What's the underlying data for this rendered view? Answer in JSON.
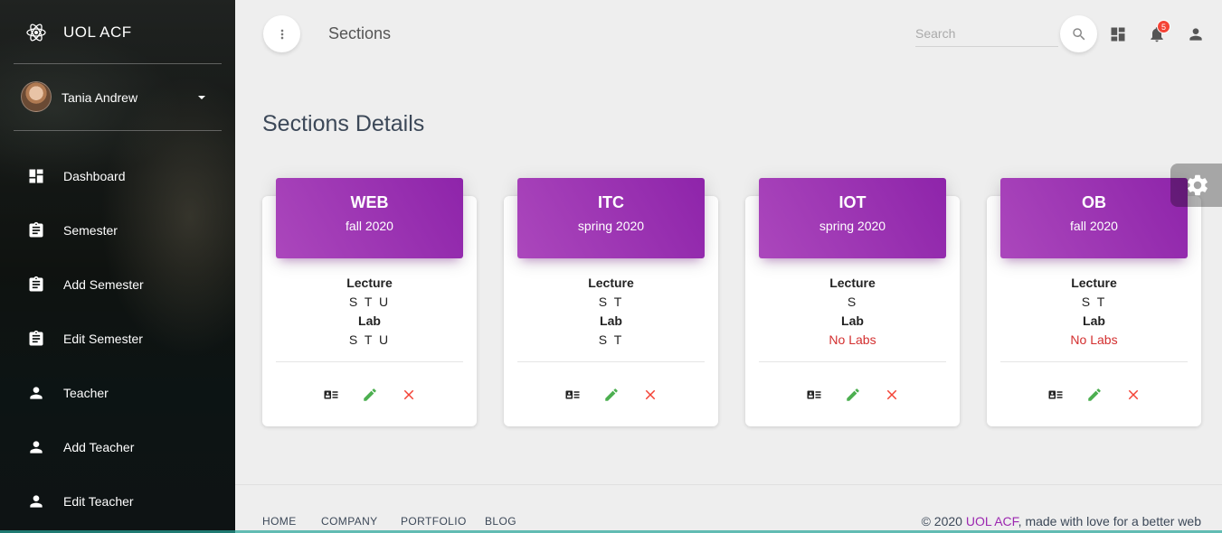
{
  "sidebar": {
    "brand": "UOL ACF",
    "user_name": "Tania Andrew",
    "items": [
      {
        "label": "Dashboard",
        "icon": "dashboard-icon"
      },
      {
        "label": "Semester",
        "icon": "clipboard-icon"
      },
      {
        "label": "Add Semester",
        "icon": "clipboard-icon"
      },
      {
        "label": "Edit Semester",
        "icon": "clipboard-icon"
      },
      {
        "label": "Teacher",
        "icon": "person-icon"
      },
      {
        "label": "Add Teacher",
        "icon": "person-icon"
      },
      {
        "label": "Edit Teacher",
        "icon": "person-icon"
      }
    ]
  },
  "header": {
    "title": "Sections",
    "search_placeholder": "Search",
    "notifications_count": "5"
  },
  "main": {
    "heading": "Sections Details",
    "cards": [
      {
        "code": "WEB",
        "term": "fall 2020",
        "lecture_label": "Lecture",
        "lecture": "S T U",
        "lab_label": "Lab",
        "lab": "S T U"
      },
      {
        "code": "ITC",
        "term": "spring 2020",
        "lecture_label": "Lecture",
        "lecture": "S T",
        "lab_label": "Lab",
        "lab": "S T"
      },
      {
        "code": "IOT",
        "term": "spring 2020",
        "lecture_label": "Lecture",
        "lecture": "S",
        "lab_label": "Lab",
        "lab": "No Labs"
      },
      {
        "code": "OB",
        "term": "fall 2020",
        "lecture_label": "Lecture",
        "lecture": "S T",
        "lab_label": "Lab",
        "lab": "No Labs"
      }
    ]
  },
  "footer": {
    "links": [
      "HOME",
      "COMPANY",
      "PORTFOLIO",
      "BLOG"
    ],
    "copyright_prefix": "© 2020 ",
    "copyright_brand": "UOL ACF",
    "copyright_suffix": ", made with love for a better web"
  },
  "colors": {
    "accent": "#9c27b0",
    "edit": "#4caf50",
    "delete": "#f44336",
    "no_labs": "#d32f2f"
  }
}
